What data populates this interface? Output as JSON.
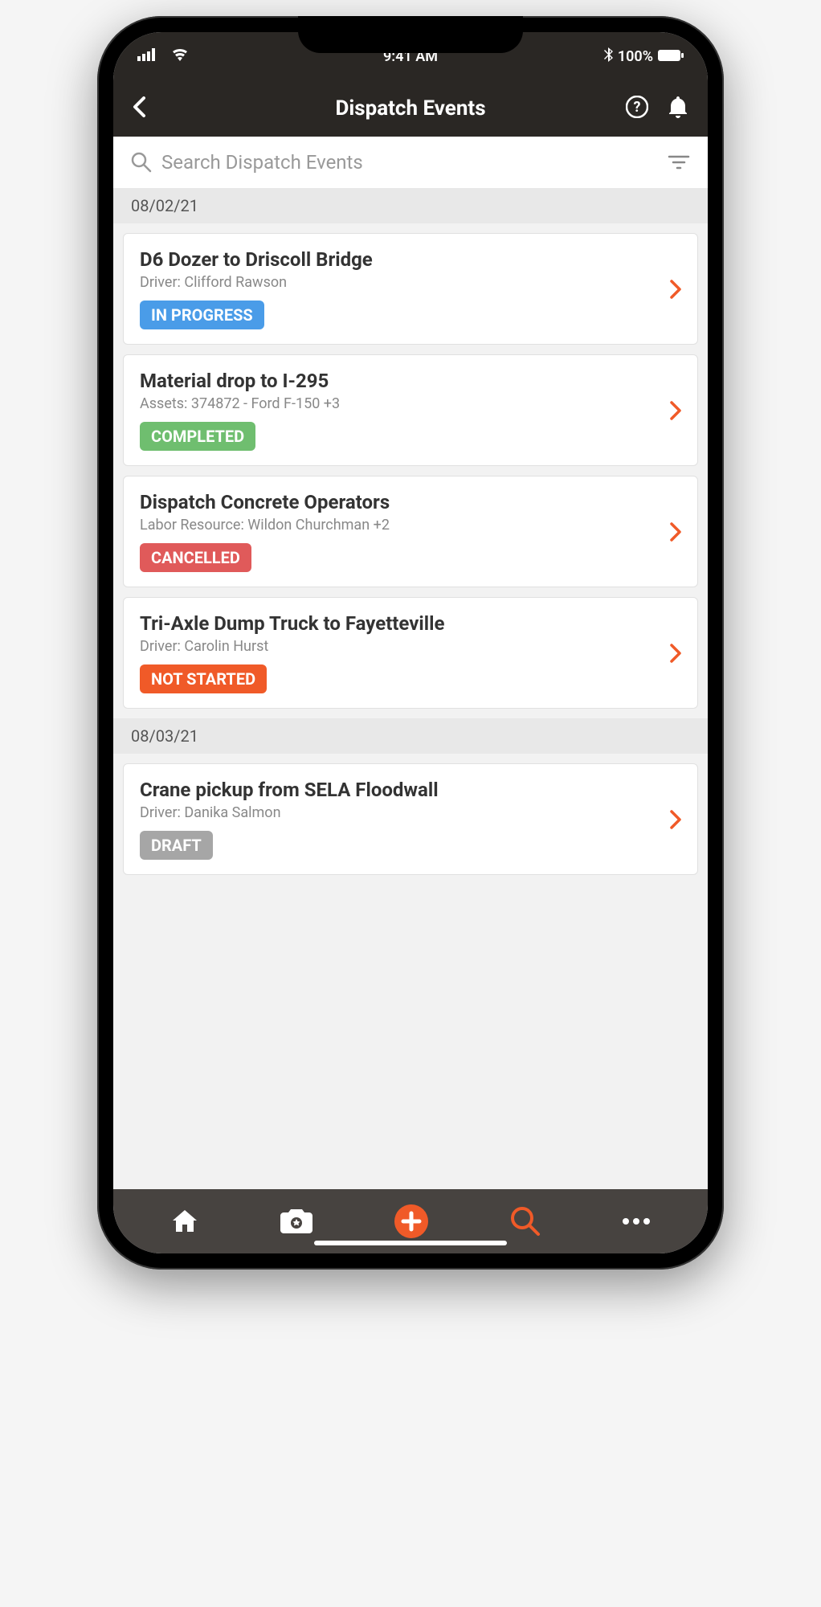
{
  "status_bar": {
    "time": "9:41 AM",
    "battery": "100%"
  },
  "header": {
    "title": "Dispatch Events"
  },
  "search": {
    "placeholder": "Search Dispatch Events"
  },
  "sections": [
    {
      "date": "08/02/21",
      "events": [
        {
          "title": "D6 Dozer to Driscoll Bridge",
          "subtitle": "Driver: Clifford Rawson",
          "status": "IN PROGRESS",
          "status_class": "badge-inprogress"
        },
        {
          "title": "Material drop to I-295",
          "subtitle": "Assets: 374872 - Ford F-150 +3",
          "status": "COMPLETED",
          "status_class": "badge-completed"
        },
        {
          "title": "Dispatch Concrete Operators",
          "subtitle": "Labor Resource: Wildon Churchman +2",
          "status": "CANCELLED",
          "status_class": "badge-cancelled"
        },
        {
          "title": "Tri-Axle Dump Truck to Fayetteville",
          "subtitle": "Driver: Carolin Hurst",
          "status": "NOT STARTED",
          "status_class": "badge-notstarted"
        }
      ]
    },
    {
      "date": "08/03/21",
      "events": [
        {
          "title": "Crane pickup from SELA Floodwall",
          "subtitle": "Driver: Danika Salmon",
          "status": "DRAFT",
          "status_class": "badge-draft"
        }
      ]
    }
  ],
  "colors": {
    "accent": "#f05a28",
    "header_bg": "#2a2724",
    "nav_bg": "#474340"
  }
}
